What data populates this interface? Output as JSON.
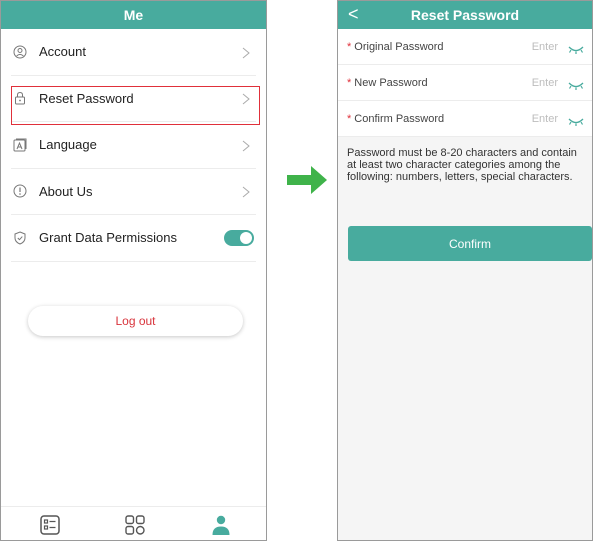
{
  "left": {
    "title": "Me",
    "menu": [
      {
        "label": "Account",
        "icon": "user-circle-icon"
      },
      {
        "label": "Reset Password",
        "icon": "lock-icon"
      },
      {
        "label": "Language",
        "icon": "language-icon"
      },
      {
        "label": "About Us",
        "icon": "info-icon"
      },
      {
        "label": "Grant Data Permissions",
        "icon": "shield-check-icon",
        "toggle": true
      }
    ],
    "logout_label": "Log out",
    "tabs": [
      "list-icon",
      "grid-icon",
      "person-icon"
    ]
  },
  "right": {
    "title": "Reset Password",
    "back_glyph": "<",
    "fields": [
      {
        "label": "Original Password",
        "placeholder": "Enter"
      },
      {
        "label": "New Password",
        "placeholder": "Enter"
      },
      {
        "label": "Confirm Password",
        "placeholder": "Enter"
      }
    ],
    "required_mark": "*",
    "hint": "Password must be 8-20 characters and contain at least two character categories among the following: numbers, letters, special characters.",
    "confirm_label": "Confirm"
  },
  "colors": {
    "accent": "#48ab9e",
    "highlight": "#e0303a",
    "arrow": "#3fb34a",
    "logout": "#d8333b"
  }
}
